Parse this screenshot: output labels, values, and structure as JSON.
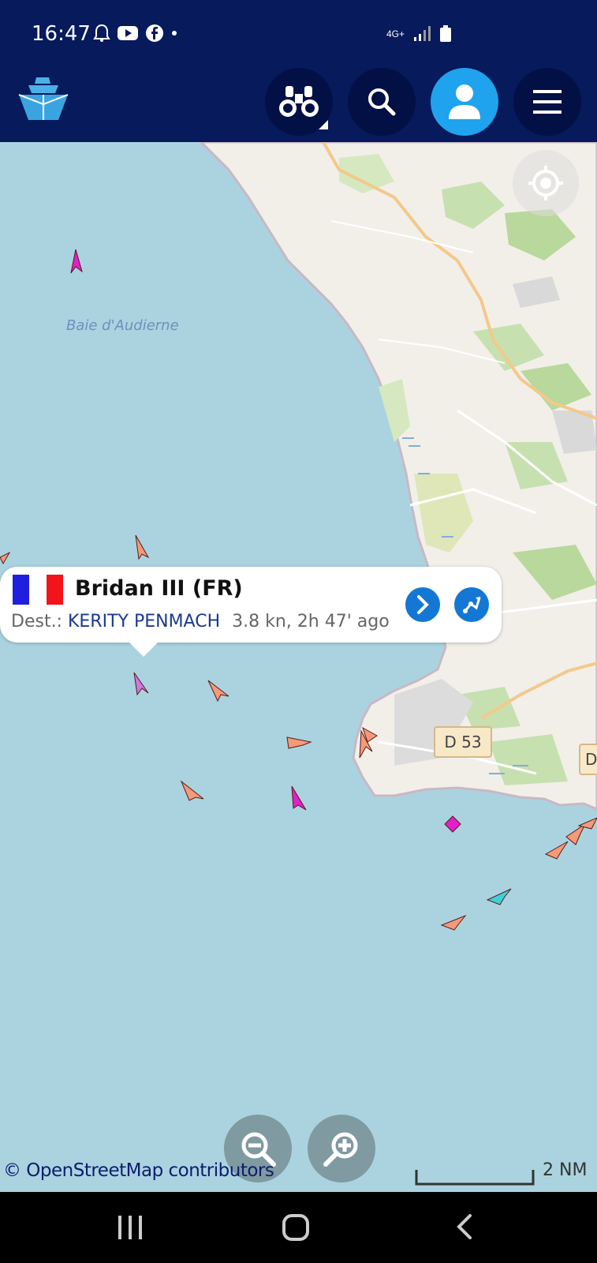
{
  "status_bar": {
    "time": "16:47",
    "network": "4G+"
  },
  "app_bar": {
    "logo_icon": "ship-logo-icon",
    "buttons": [
      "binoculars-icon",
      "search-icon",
      "user-icon",
      "menu-icon"
    ]
  },
  "map": {
    "place_label": "Baie d'Audierne",
    "road_label": "D 53",
    "road_label_partial": "D",
    "attribution": "© OpenStreetMap contributors",
    "scale_label": "2 NM"
  },
  "popup": {
    "flag": "france-flag-icon",
    "vessel_name": "Bridan III (FR)",
    "dest_prefix": "Dest.:",
    "destination": "KERITY PENMACH",
    "speed_time": "3.8 kn, 2h 47' ago"
  },
  "colors": {
    "app_bar": "#061a5c",
    "sea": "#aad3df",
    "land": "#f2efe9",
    "accent_blue": "#1477d4"
  }
}
